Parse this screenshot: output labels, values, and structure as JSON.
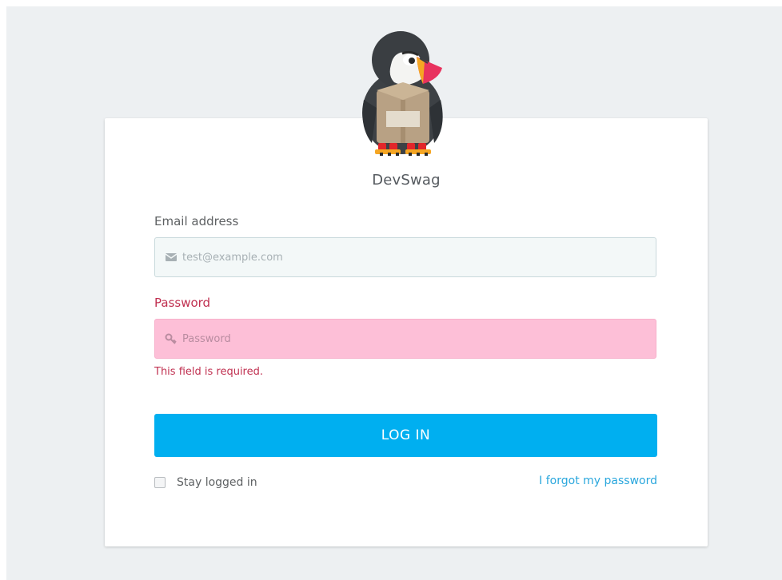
{
  "shop": {
    "name": "DevSwag",
    "logo_icon": "puffin-mascot-icon"
  },
  "form": {
    "email": {
      "label": "Email address",
      "placeholder": "test@example.com",
      "value": "",
      "icon": "envelope-icon"
    },
    "password": {
      "label": "Password",
      "placeholder": "Password",
      "value": "",
      "icon": "key-icon",
      "error": "This field is required."
    },
    "submit_label": "LOG IN",
    "stay_logged_in_label": "Stay logged in",
    "stay_logged_in_checked": false,
    "forgot_password_label": "I forgot my password"
  },
  "colors": {
    "background": "#edf0f2",
    "accent": "#00aff0",
    "error": "#c03050",
    "error_field_bg": "#fdbfd7",
    "link": "#2aa7dd"
  }
}
